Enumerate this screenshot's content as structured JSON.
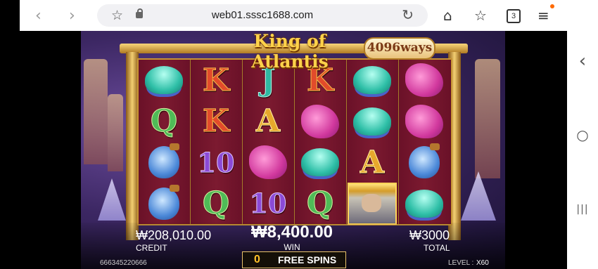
{
  "browser": {
    "back_icon": "‹",
    "forward_icon": "›",
    "url": "web01.sssc1688.com",
    "tab_count": "3",
    "home_icon": "⌂",
    "favorites_icon": "☆",
    "reload_icon": "↻",
    "menu_icon": "≡",
    "accent": "#ff6a00"
  },
  "system_nav": {
    "back_icon": "‹",
    "home_icon": "○",
    "recents_icon": "|||"
  },
  "game": {
    "title": "King of Atlantis",
    "ways": "4096ways",
    "reels": [
      [
        "shell",
        "Q",
        "bottle",
        "bottle"
      ],
      [
        "K",
        "K",
        "10",
        "Q"
      ],
      [
        "J",
        "A",
        "seahorse",
        "10"
      ],
      [
        "K",
        "seahorse",
        "shell",
        "Q"
      ],
      [
        "shell",
        "shell",
        "A",
        "king"
      ],
      [
        "seahorse",
        "seahorse",
        "bottle",
        "shell"
      ]
    ],
    "credit_value": "₩208,010.00",
    "credit_label": "CREDIT",
    "win_value": "₩8,400.00",
    "win_label": "WIN",
    "total_value": "₩3000",
    "total_label": "TOTAL",
    "free_spins_count": "0",
    "free_spins_label": "FREE SPINS",
    "session_id": "666345220666",
    "level_label": "LEVEL :",
    "level_value": "X60"
  }
}
